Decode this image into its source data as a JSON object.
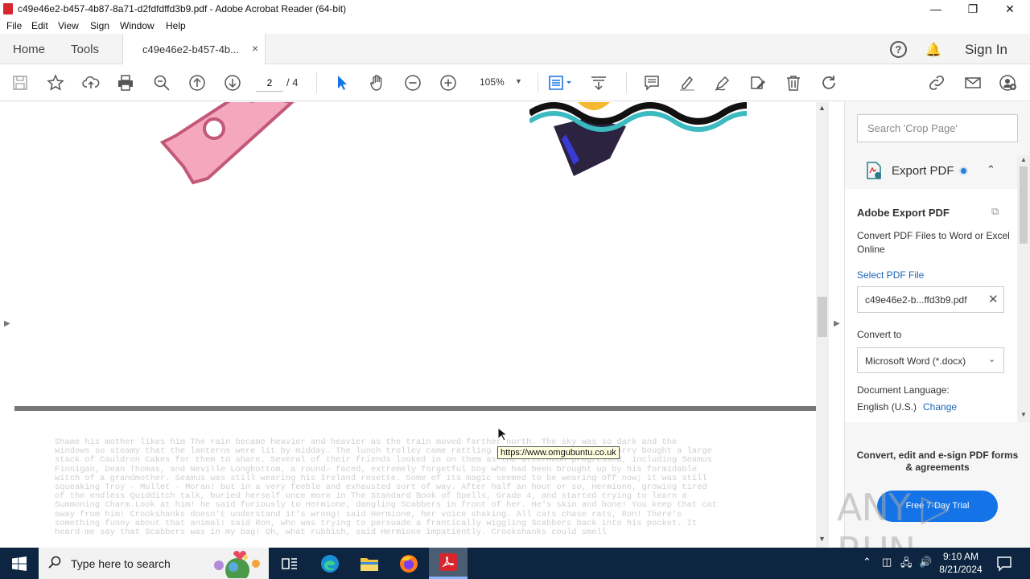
{
  "window": {
    "title": "c49e46e2-b457-4b87-8a71-d2fdfdffd3b9.pdf - Adobe Acrobat Reader (64-bit)",
    "minimize": "—",
    "restore": "❐",
    "close": "✕"
  },
  "menu": [
    "File",
    "Edit",
    "View",
    "Sign",
    "Window",
    "Help"
  ],
  "tabs": {
    "home": "Home",
    "tools": "Tools",
    "doc_tab": "c49e46e2-b457-4b...",
    "doc_close": "×",
    "help": "?",
    "sign_in": "Sign In"
  },
  "toolbar": {
    "page_current": "2",
    "page_total": "/ 4",
    "zoom": "105%"
  },
  "document": {
    "page2_text": "     Shame his mother likes him The rain became heavier and heavier as the train moved farther north. The sky was so dark and the\nwindows so steamy that the lanterns were lit by midday. The lunch trolley came rattling along the corridor and Harry bought a large\nstack of Cauldron Cakes for them to share. Several of their friends looked in on them as the afternoon progressed, including Seamus\nFinnigan, Dean Thomas, and Neville Longbottom, a round- faced, extremely forgetful boy who had been brought up by his formidable\nwitch of a grandmother. Seamus was still wearing his Ireland rosette. Some of its magic seemed to be wearing off now; it was still\nsqueaking Troy - Mullet - Moran! but in a very feeble and exhausted sort of way. After half an hour or so, Hermione, growing tired\nof the endless Quidditch talk, buried herself once more in The Standard Book of Spells, Grade 4, and started trying to learn a\nSummoning Charm.Look at him! he said furiously to Hermione, dangling Scabbers in front of her. He's skin and bone! You keep that cat\naway from him! Crookshanks doesn't understand it's wrong! said Hermione, her voice shaking. All cats chase rats, Ron! There's\nsomething funny about that animal! said Ron, who was trying to persuade a frantically wiggling Scabbers back into his pocket. It\nheard me say that Scabbers was in my bag! Oh, what rubbish, said Hermione impatiently. Crookshanks could smell",
    "tooltip": "https://www.omgubuntu.co.uk"
  },
  "panel": {
    "search_placeholder": "Search 'Crop Page'",
    "export_label": "Export PDF",
    "card_title": "Adobe Export PDF",
    "card_desc": "Convert PDF Files to Word or Excel Online",
    "select_file": "Select PDF File",
    "file_name": "c49e46e2-b...ffd3b9.pdf",
    "convert_to_label": "Convert to",
    "convert_to_value": "Microsoft Word (*.docx)",
    "doc_lang_label": "Document Language:",
    "doc_lang_value": "English (U.S.)",
    "change": "Change",
    "promo": "Convert, edit and e-sign PDF forms & agreements",
    "trial_button": "Free 7-Day Trial",
    "watermark": "ANY ▷ RUN"
  },
  "taskbar": {
    "search_text": "Type here to search",
    "time": "9:10 AM",
    "date": "8/21/2024"
  },
  "colors": {
    "accent_blue": "#1473e6",
    "link_blue": "#1a64b8",
    "taskbar_bg": "#0d2540"
  }
}
